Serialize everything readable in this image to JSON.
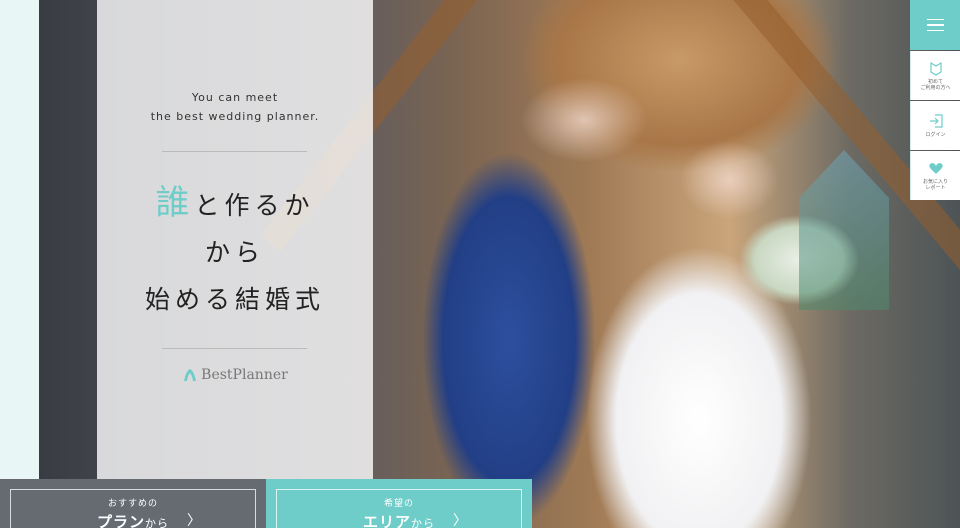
{
  "hero": {
    "tagline_line1": "You can meet",
    "tagline_line2": "the best wedding planner.",
    "headline_accent": "誰",
    "headline_line1_rest": "と作るか",
    "headline_line2": "から",
    "headline_line3": "始める結婚式",
    "logo_text": "BestPlanner"
  },
  "side_nav": {
    "items": [
      {
        "icon": "first-time-icon",
        "label": "初めて\nご利用の方へ"
      },
      {
        "icon": "login-icon",
        "label": "ログイン"
      },
      {
        "icon": "heart-icon",
        "label": "お気に入り\nレポート"
      }
    ]
  },
  "cta": {
    "plan": {
      "small": "おすすめの",
      "big": "プラン",
      "suffix": "から",
      "chevron": "〉"
    },
    "area": {
      "small": "希望の",
      "big": "エリア",
      "suffix": "から",
      "chevron": "〉"
    }
  },
  "colors": {
    "accent": "#6fcdc9",
    "plan_bg": "#666b72",
    "page_bg": "#e8f6f5"
  }
}
